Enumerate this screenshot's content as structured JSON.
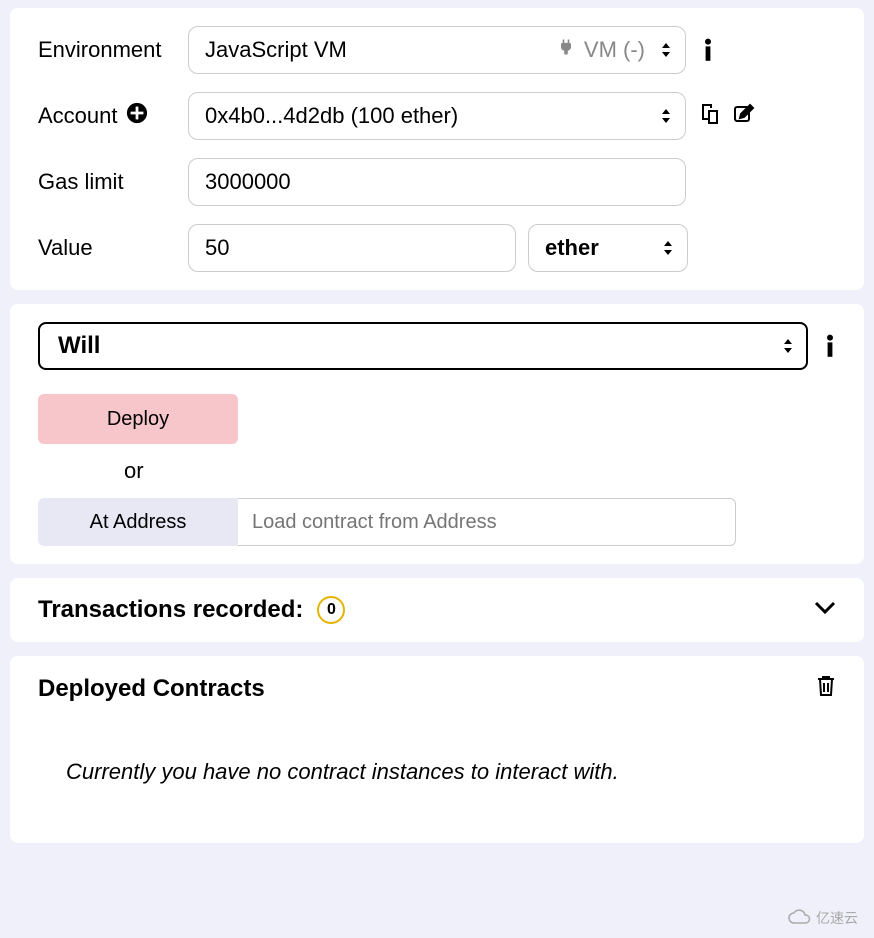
{
  "settings": {
    "environment": {
      "label": "Environment",
      "value": "JavaScript VM",
      "vm_status": "VM (-)"
    },
    "account": {
      "label": "Account",
      "value": "0x4b0...4d2db (100 ether)"
    },
    "gas_limit": {
      "label": "Gas limit",
      "value": "3000000"
    },
    "value": {
      "label": "Value",
      "amount": "50",
      "unit": "ether"
    }
  },
  "contract": {
    "selected": "Will",
    "deploy_label": "Deploy",
    "or_label": "or",
    "at_address_label": "At Address",
    "load_placeholder": "Load contract from Address"
  },
  "transactions": {
    "title": "Transactions recorded:",
    "count": "0"
  },
  "deployed": {
    "title": "Deployed Contracts",
    "empty_message": "Currently you have no contract instances to interact with."
  },
  "watermark": "亿速云"
}
